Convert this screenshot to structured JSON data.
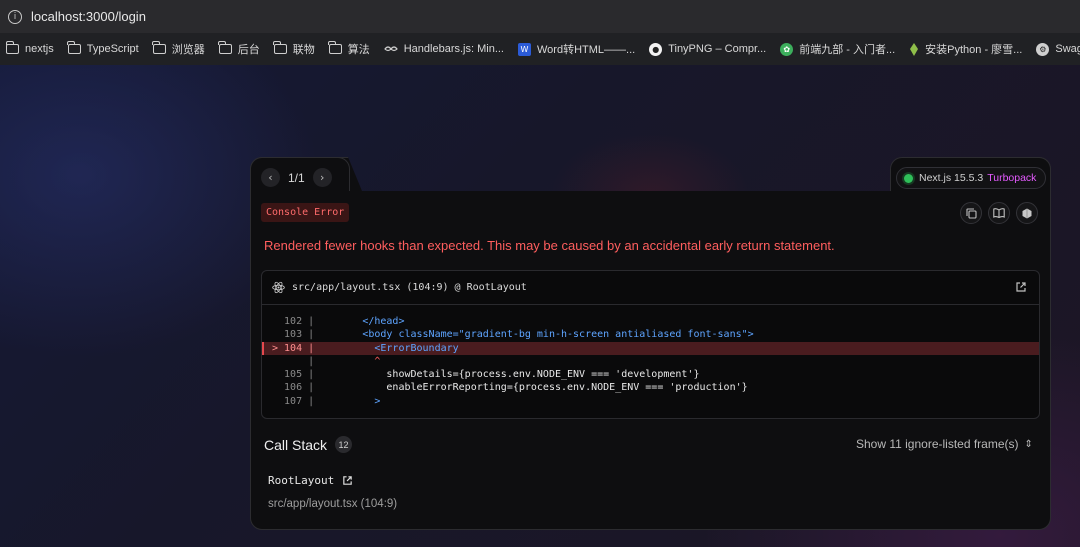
{
  "browser": {
    "url": "localhost:3000/login",
    "bookmarks": [
      {
        "label": "nextjs",
        "icon": "folder-icon"
      },
      {
        "label": "TypeScript",
        "icon": "folder-icon"
      },
      {
        "label": "浏览器",
        "icon": "folder-icon"
      },
      {
        "label": "后台",
        "icon": "folder-icon"
      },
      {
        "label": "联物",
        "icon": "folder-icon"
      },
      {
        "label": "算法",
        "icon": "folder-icon"
      },
      {
        "label": "Handlebars.js: Min...",
        "icon": "handlebars-icon"
      },
      {
        "label": "Word转HTML——...",
        "icon": "word-icon"
      },
      {
        "label": "TinyPNG – Compr...",
        "icon": "panda-icon"
      },
      {
        "label": "前端九部 - 入门者...",
        "icon": "leaf-icon"
      },
      {
        "label": "安装Python - 廖雪...",
        "icon": "python-icon"
      },
      {
        "label": "Swagge",
        "icon": "swagger-icon"
      }
    ]
  },
  "overlay": {
    "pager": {
      "count": "1/1"
    },
    "badge": {
      "version": "Next.js 15.5.3",
      "bundler": "Turbopack"
    },
    "label": "Console Error",
    "message": "Rendered fewer hooks than expected. This may be caused by an accidental early return statement.",
    "code_frame": {
      "file": "src/app/layout.tsx (104:9) @ RootLayout",
      "lines": [
        {
          "gutter": "  102 |",
          "code": "        </head>"
        },
        {
          "gutter": "  103 |",
          "code": "        <body className=\"gradient-bg min-h-screen antialiased font-sans\">"
        },
        {
          "gutter": "> 104 |",
          "code": "          <ErrorBoundary"
        },
        {
          "gutter": "      |",
          "code": "          ^"
        },
        {
          "gutter": "  105 |",
          "code": "            showDetails={process.env.NODE_ENV === 'development'}"
        },
        {
          "gutter": "  106 |",
          "code": "            enableErrorReporting={process.env.NODE_ENV === 'production'}"
        },
        {
          "gutter": "  107 |",
          "code": "          >"
        }
      ]
    },
    "call_stack": {
      "title": "Call Stack",
      "count": "12",
      "toggle": "Show 11 ignore-listed frame(s)",
      "frames": [
        {
          "name": "RootLayout",
          "location": "src/app/layout.tsx (104:9)"
        }
      ]
    }
  }
}
